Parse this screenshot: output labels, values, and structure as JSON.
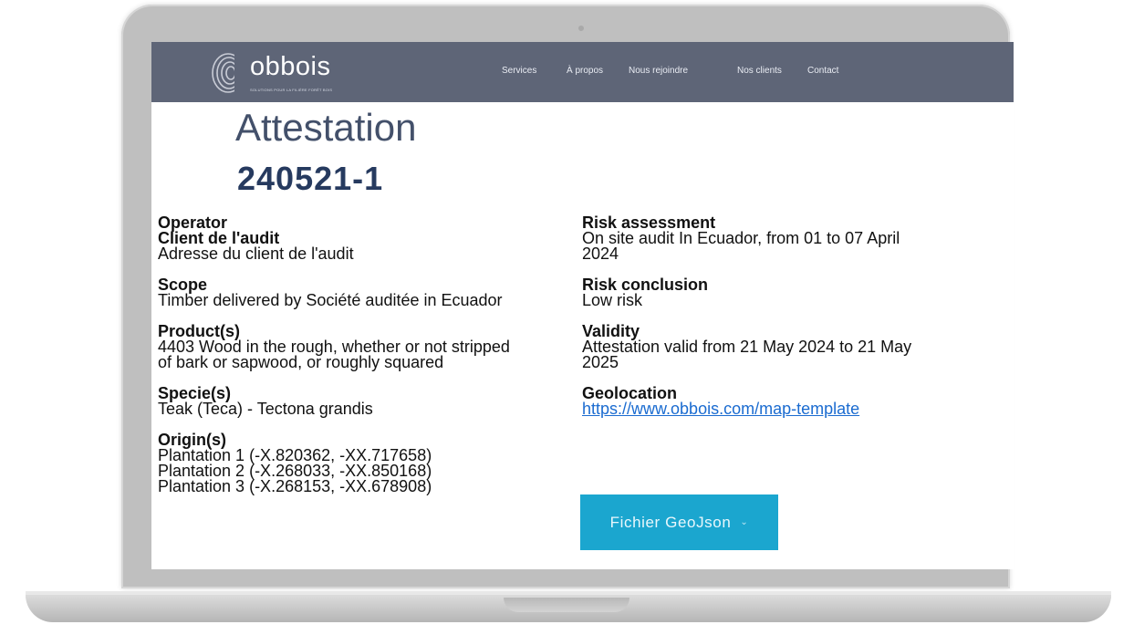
{
  "site": {
    "brand": "obbois",
    "tagline": "SOLUTIONS POUR LA FILIÈRE FORÊT BOIS",
    "nav": [
      "Services",
      "À propos",
      "Nous rejoindre",
      "Nos clients",
      "Contact"
    ]
  },
  "page": {
    "title": "Attestation",
    "number": "240521-1"
  },
  "left_fields": [
    {
      "label": "Operator",
      "lines": []
    },
    {
      "label": "Client de l'audit",
      "lines": [
        "Adresse du client de l'audit"
      ]
    },
    {
      "label": "Scope",
      "lines": [
        "Timber delivered by Société auditée in Ecuador"
      ]
    },
    {
      "label": "Product(s)",
      "lines": [
        "4403 Wood in the rough, whether or not stripped",
        "of bark or sapwood, or roughly squared"
      ]
    },
    {
      "label": "Specie(s)",
      "lines": [
        "Teak (Teca) - Tectona grandis"
      ]
    },
    {
      "label": "Origin(s)",
      "lines": [
        "Plantation 1 (-X.820362, -XX.717658)",
        "Plantation 2 (-X.268033, -XX.850168)",
        "Plantation 3 (-X.268153, -XX.678908)"
      ]
    }
  ],
  "right_fields": [
    {
      "label": "Risk assessment",
      "lines": [
        "On site audit In Ecuador, from 01 to 07 April",
        "2024"
      ]
    },
    {
      "label": "Risk conclusion",
      "lines": [
        "Low risk"
      ]
    },
    {
      "label": "Validity",
      "lines": [
        "Attestation valid from 21 May 2024 to 21 May",
        "2025"
      ]
    },
    {
      "label": "Geolocation",
      "link": "https://www.obbois.com/map-template"
    }
  ],
  "geojson_button": {
    "label": "Fichier GeoJson",
    "icon": "chevron-down-icon"
  },
  "colors": {
    "navbar": "#5e6577",
    "accent": "#1ba6cf",
    "title": "#43506a",
    "number": "#263a5f",
    "link": "#1a6bd0"
  }
}
